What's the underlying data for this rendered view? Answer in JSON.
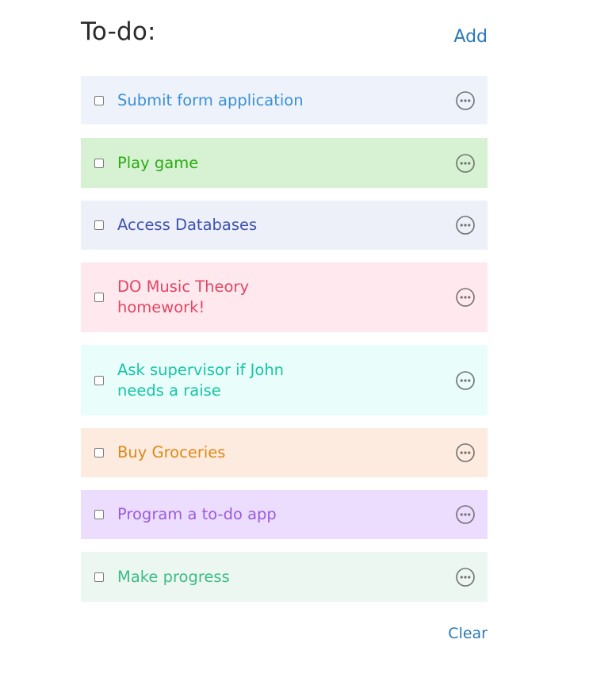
{
  "header": {
    "title": "To-do:",
    "add_label": "Add"
  },
  "tasks": [
    {
      "label": "Submit form application",
      "bg": "#eef3fb",
      "color": "#3b8fd6",
      "checked": false
    },
    {
      "label": "Play game",
      "bg": "#d6f2d2",
      "color": "#2bab12",
      "checked": false
    },
    {
      "label": "Access Databases",
      "bg": "#eef0f9",
      "color": "#3e52b0",
      "checked": false
    },
    {
      "label": "DO Music Theory homework!",
      "bg": "#ffe9ee",
      "color": "#e04563",
      "checked": false
    },
    {
      "label": "Ask supervisor if John needs a raise",
      "bg": "#e9fdfa",
      "color": "#17c6a6",
      "checked": false
    },
    {
      "label": "Buy Groceries",
      "bg": "#fdebe0",
      "color": "#dd8a16",
      "checked": false
    },
    {
      "label": "Program a to-do app",
      "bg": "#ecdcfd",
      "color": "#9a5cdc",
      "checked": false
    },
    {
      "label": "Make progress",
      "bg": "#edf7f2",
      "color": "#3dbb86",
      "checked": false
    }
  ],
  "footer": {
    "clear_label": "Clear"
  },
  "icons": {
    "more": "more-options-icon",
    "checkbox": "checkbox-icon"
  },
  "colors": {
    "link": "#2a79b8",
    "title": "#2b2b2b",
    "icon": "#707070"
  }
}
